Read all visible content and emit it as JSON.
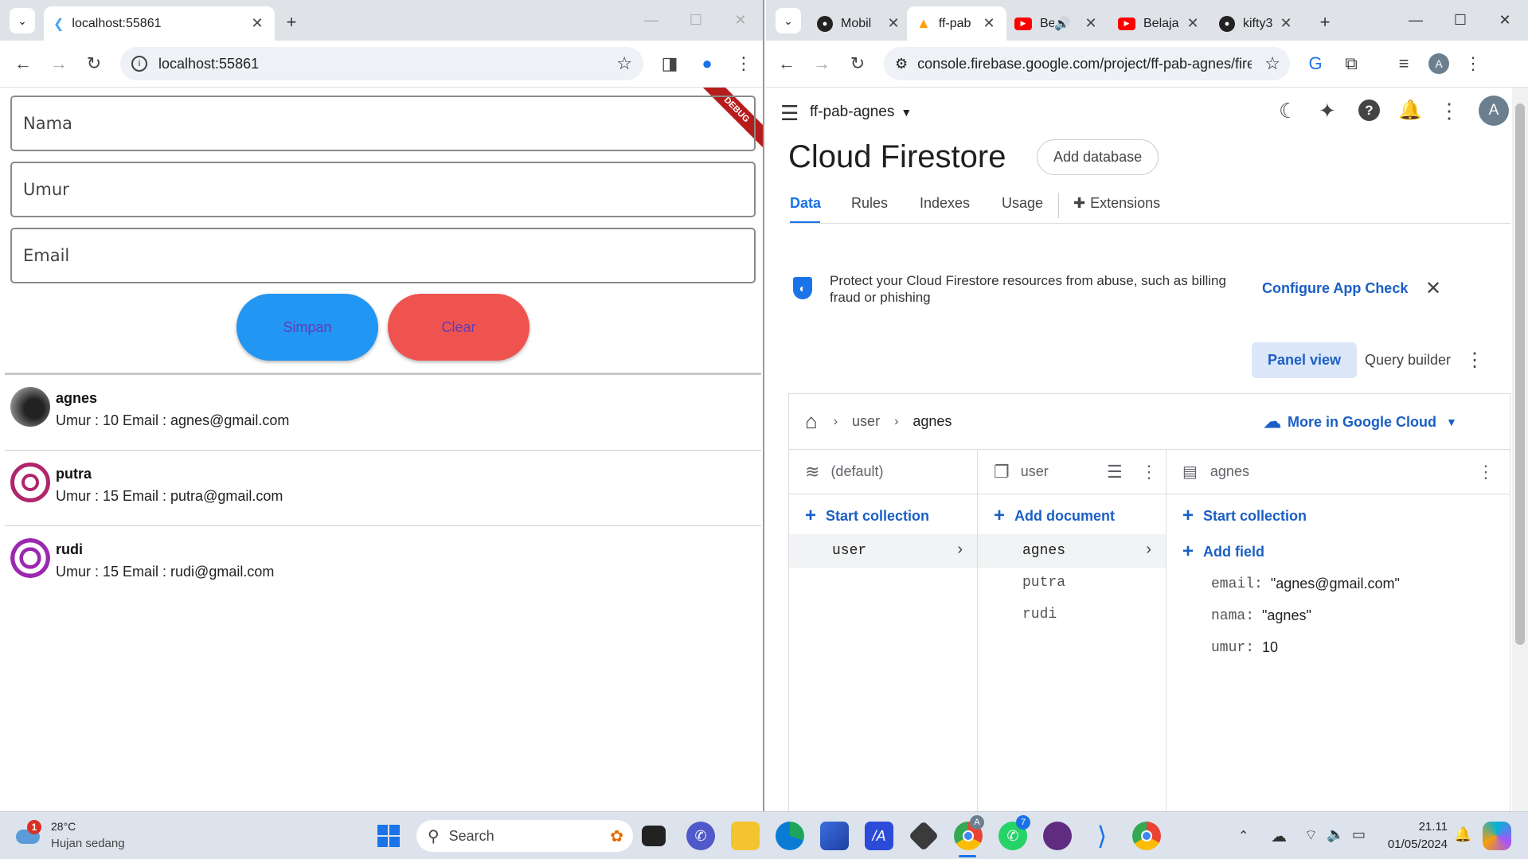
{
  "left_window": {
    "tab_title": "localhost:55861",
    "url": "localhost:55861",
    "debug_banner": "DEBUG",
    "form": {
      "nama_label": "Nama",
      "umur_label": "Umur",
      "email_label": "Email",
      "save_label": "Simpan",
      "clear_label": "Clear"
    },
    "list": [
      {
        "name": "agnes",
        "detail": "Umur : 10 Email : agnes@gmail.com"
      },
      {
        "name": "putra",
        "detail": "Umur : 15 Email : putra@gmail.com"
      },
      {
        "name": "rudi",
        "detail": "Umur : 15 Email : rudi@gmail.com"
      }
    ]
  },
  "right_window": {
    "tabs": [
      {
        "label": "Mobil",
        "icon": "github-icon"
      },
      {
        "label": "ff-pab",
        "icon": "firebase-icon"
      },
      {
        "label": "Be",
        "icon": "youtube-icon"
      },
      {
        "label": "Belaja",
        "icon": "youtube-icon"
      },
      {
        "label": "kifty3",
        "icon": "github-icon"
      }
    ],
    "url": "console.firebase.google.com/project/ff-pab-agnes/firest...",
    "profile_initial": "A",
    "project_name": "ff-pab-agnes",
    "page_title": "Cloud Firestore",
    "add_database_label": "Add database",
    "nav_tabs": [
      "Data",
      "Rules",
      "Indexes",
      "Usage",
      "Extensions"
    ],
    "banner": {
      "text_line1": "Protect your Cloud Firestore resources from abuse, such as billing",
      "text_line2": "fraud or phishing",
      "action": "Configure App Check"
    },
    "view_toggle": {
      "panel": "Panel view",
      "query": "Query builder"
    },
    "breadcrumb": {
      "collection": "user",
      "document": "agnes"
    },
    "more_cloud_label": "More in Google Cloud",
    "columns": {
      "root": {
        "title": "(default)",
        "action": "Start collection",
        "items": [
          "user"
        ]
      },
      "collection": {
        "title": "user",
        "action": "Add document",
        "items": [
          "agnes",
          "putra",
          "rudi"
        ]
      },
      "document": {
        "title": "agnes",
        "action": "Start collection",
        "add_field": "Add field",
        "fields": [
          {
            "key": "email:",
            "value": "\"agnes@gmail.com\""
          },
          {
            "key": "nama:",
            "value": "\"agnes\""
          },
          {
            "key": "umur:",
            "value": "10"
          }
        ]
      }
    }
  },
  "taskbar": {
    "weather_temp": "28°C",
    "weather_desc": "Hujan sedang",
    "weather_badge": "1",
    "search_placeholder": "Search",
    "chrome_badge": "A",
    "whatsapp_badge": "7",
    "time": "21.11",
    "date": "01/05/2024"
  },
  "colors": {
    "simpan_button": "#2196f3",
    "clear_button": "#ef5350",
    "firebase_blue": "#1a73e8"
  }
}
